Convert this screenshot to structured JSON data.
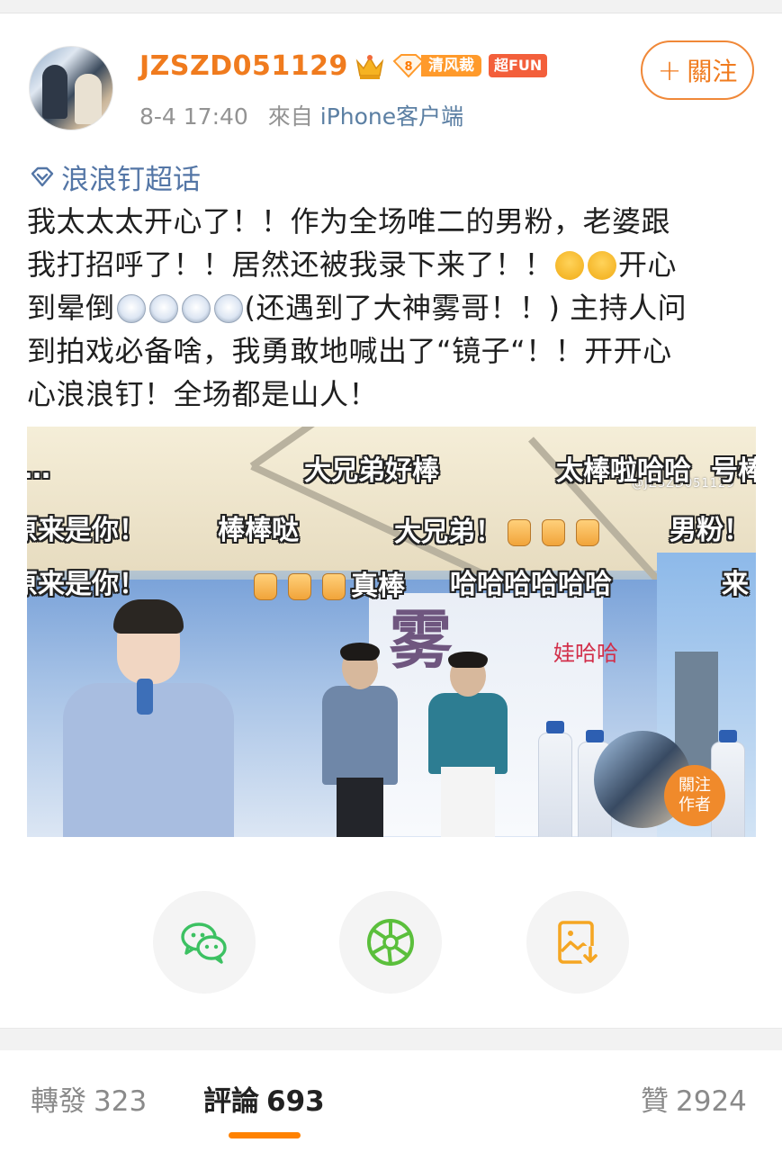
{
  "post": {
    "username": "JZSZD051129",
    "level_number": "8",
    "badge_label": "清风裁",
    "fun_badge": "超FUN",
    "time": "8-4 17:40",
    "source_prefix": "來自",
    "source": "iPhone客户端",
    "follow_label": "關注",
    "topic": "浪浪钉超话",
    "text_line1": "我太太太开心了！！作为全场唯二的男粉，老婆跟",
    "text_line2a": "我打招呼了！！居然还被我录下来了！！",
    "text_line2b": "开心",
    "text_line3a": "到晕倒",
    "text_line3b": "(还遇到了大神雾哥！！) 主持人问",
    "text_line4": "到拍戏必备啥，我勇敢地喊出了“镜子“！！开开心",
    "text_line5": "心浪浪钉！全场都是山人！"
  },
  "video": {
    "watermark": "@JZSZD051129",
    "brand": "娃哈哈",
    "calligraphy": "雾",
    "danmaku": {
      "d1": "大兄弟好棒",
      "d2": "太棒啦哈哈",
      "d3": "原来是你！",
      "d4": "棒棒哒",
      "d5": "大兄弟！",
      "d6": "男粉！",
      "d7": "原来是你！",
      "d8": "真棒",
      "d9": "哈哈哈哈哈哈",
      "d10": "来",
      "d11": "…",
      "d12": "号棒"
    },
    "corner_follow_line1": "關注",
    "corner_follow_line2": "作者"
  },
  "share": {
    "icons": [
      "wechat-icon",
      "moments-icon",
      "save-image-icon"
    ]
  },
  "tabs": {
    "repost_label": "轉發",
    "repost_count": "323",
    "comment_label": "評論",
    "comment_count": "693",
    "like_label": "贊",
    "like_count": "2924"
  },
  "colors": {
    "accent_orange": "#ff8200",
    "username": "#f07b1e",
    "topic_link": "#5476a6",
    "wechat_green": "#3cc162"
  }
}
